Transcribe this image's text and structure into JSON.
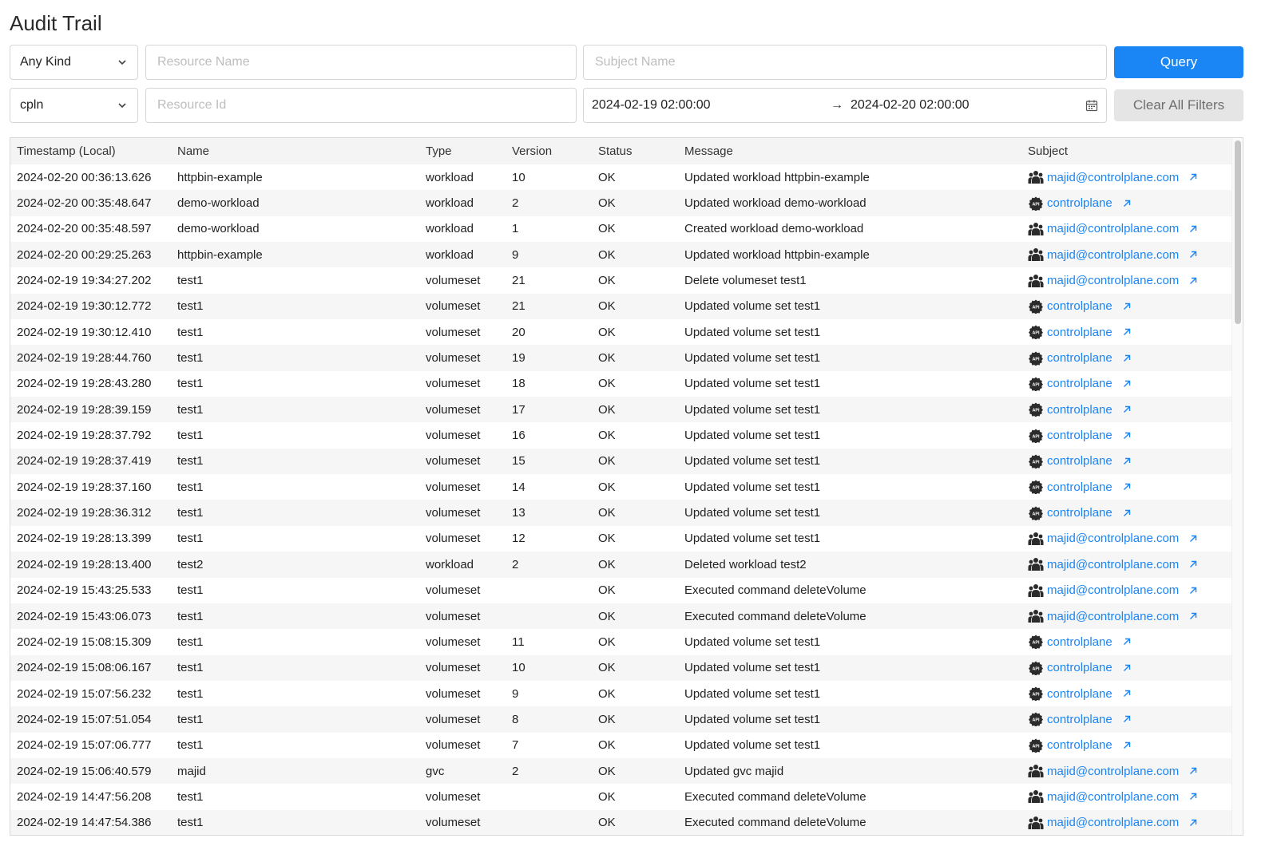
{
  "title": "Audit Trail",
  "filters": {
    "kind": "Any Kind",
    "resource_name_placeholder": "Resource Name",
    "subject_name_placeholder": "Subject Name",
    "context": "cpln",
    "resource_id_placeholder": "Resource Id",
    "date_from": "2024-02-19 02:00:00",
    "date_arrow": "→",
    "date_to": "2024-02-20 02:00:00",
    "query_label": "Query",
    "clear_label": "Clear All Filters"
  },
  "columns": {
    "timestamp": "Timestamp (Local)",
    "name": "Name",
    "type": "Type",
    "version": "Version",
    "status": "Status",
    "message": "Message",
    "subject": "Subject"
  },
  "rows": [
    {
      "timestamp": "2024-02-20 00:36:13.626",
      "name": "httpbin-example",
      "type": "workload",
      "version": "10",
      "status": "OK",
      "message": "Updated workload httpbin-example",
      "subject": "majid@controlplane.com",
      "subject_icon": "users-icon"
    },
    {
      "timestamp": "2024-02-20 00:35:48.647",
      "name": "demo-workload",
      "type": "workload",
      "version": "2",
      "status": "OK",
      "message": "Updated workload demo-workload",
      "subject": "controlplane",
      "subject_icon": "api-icon"
    },
    {
      "timestamp": "2024-02-20 00:35:48.597",
      "name": "demo-workload",
      "type": "workload",
      "version": "1",
      "status": "OK",
      "message": "Created workload demo-workload",
      "subject": "majid@controlplane.com",
      "subject_icon": "users-icon"
    },
    {
      "timestamp": "2024-02-20 00:29:25.263",
      "name": "httpbin-example",
      "type": "workload",
      "version": "9",
      "status": "OK",
      "message": "Updated workload httpbin-example",
      "subject": "majid@controlplane.com",
      "subject_icon": "users-icon"
    },
    {
      "timestamp": "2024-02-19 19:34:27.202",
      "name": "test1",
      "type": "volumeset",
      "version": "21",
      "status": "OK",
      "message": "Delete volumeset test1",
      "subject": "majid@controlplane.com",
      "subject_icon": "users-icon"
    },
    {
      "timestamp": "2024-02-19 19:30:12.772",
      "name": "test1",
      "type": "volumeset",
      "version": "21",
      "status": "OK",
      "message": "Updated volume set test1",
      "subject": "controlplane",
      "subject_icon": "api-icon"
    },
    {
      "timestamp": "2024-02-19 19:30:12.410",
      "name": "test1",
      "type": "volumeset",
      "version": "20",
      "status": "OK",
      "message": "Updated volume set test1",
      "subject": "controlplane",
      "subject_icon": "api-icon"
    },
    {
      "timestamp": "2024-02-19 19:28:44.760",
      "name": "test1",
      "type": "volumeset",
      "version": "19",
      "status": "OK",
      "message": "Updated volume set test1",
      "subject": "controlplane",
      "subject_icon": "api-icon"
    },
    {
      "timestamp": "2024-02-19 19:28:43.280",
      "name": "test1",
      "type": "volumeset",
      "version": "18",
      "status": "OK",
      "message": "Updated volume set test1",
      "subject": "controlplane",
      "subject_icon": "api-icon"
    },
    {
      "timestamp": "2024-02-19 19:28:39.159",
      "name": "test1",
      "type": "volumeset",
      "version": "17",
      "status": "OK",
      "message": "Updated volume set test1",
      "subject": "controlplane",
      "subject_icon": "api-icon"
    },
    {
      "timestamp": "2024-02-19 19:28:37.792",
      "name": "test1",
      "type": "volumeset",
      "version": "16",
      "status": "OK",
      "message": "Updated volume set test1",
      "subject": "controlplane",
      "subject_icon": "api-icon"
    },
    {
      "timestamp": "2024-02-19 19:28:37.419",
      "name": "test1",
      "type": "volumeset",
      "version": "15",
      "status": "OK",
      "message": "Updated volume set test1",
      "subject": "controlplane",
      "subject_icon": "api-icon"
    },
    {
      "timestamp": "2024-02-19 19:28:37.160",
      "name": "test1",
      "type": "volumeset",
      "version": "14",
      "status": "OK",
      "message": "Updated volume set test1",
      "subject": "controlplane",
      "subject_icon": "api-icon"
    },
    {
      "timestamp": "2024-02-19 19:28:36.312",
      "name": "test1",
      "type": "volumeset",
      "version": "13",
      "status": "OK",
      "message": "Updated volume set test1",
      "subject": "controlplane",
      "subject_icon": "api-icon"
    },
    {
      "timestamp": "2024-02-19 19:28:13.399",
      "name": "test1",
      "type": "volumeset",
      "version": "12",
      "status": "OK",
      "message": "Updated volume set test1",
      "subject": "majid@controlplane.com",
      "subject_icon": "users-icon"
    },
    {
      "timestamp": "2024-02-19 19:28:13.400",
      "name": "test2",
      "type": "workload",
      "version": "2",
      "status": "OK",
      "message": "Deleted workload test2",
      "subject": "majid@controlplane.com",
      "subject_icon": "users-icon"
    },
    {
      "timestamp": "2024-02-19 15:43:25.533",
      "name": "test1",
      "type": "volumeset",
      "version": "",
      "status": "OK",
      "message": "Executed command deleteVolume",
      "subject": "majid@controlplane.com",
      "subject_icon": "users-icon"
    },
    {
      "timestamp": "2024-02-19 15:43:06.073",
      "name": "test1",
      "type": "volumeset",
      "version": "",
      "status": "OK",
      "message": "Executed command deleteVolume",
      "subject": "majid@controlplane.com",
      "subject_icon": "users-icon"
    },
    {
      "timestamp": "2024-02-19 15:08:15.309",
      "name": "test1",
      "type": "volumeset",
      "version": "11",
      "status": "OK",
      "message": "Updated volume set test1",
      "subject": "controlplane",
      "subject_icon": "api-icon"
    },
    {
      "timestamp": "2024-02-19 15:08:06.167",
      "name": "test1",
      "type": "volumeset",
      "version": "10",
      "status": "OK",
      "message": "Updated volume set test1",
      "subject": "controlplane",
      "subject_icon": "api-icon"
    },
    {
      "timestamp": "2024-02-19 15:07:56.232",
      "name": "test1",
      "type": "volumeset",
      "version": "9",
      "status": "OK",
      "message": "Updated volume set test1",
      "subject": "controlplane",
      "subject_icon": "api-icon"
    },
    {
      "timestamp": "2024-02-19 15:07:51.054",
      "name": "test1",
      "type": "volumeset",
      "version": "8",
      "status": "OK",
      "message": "Updated volume set test1",
      "subject": "controlplane",
      "subject_icon": "api-icon"
    },
    {
      "timestamp": "2024-02-19 15:07:06.777",
      "name": "test1",
      "type": "volumeset",
      "version": "7",
      "status": "OK",
      "message": "Updated volume set test1",
      "subject": "controlplane",
      "subject_icon": "api-icon"
    },
    {
      "timestamp": "2024-02-19 15:06:40.579",
      "name": "majid",
      "type": "gvc",
      "version": "2",
      "status": "OK",
      "message": "Updated gvc majid",
      "subject": "majid@controlplane.com",
      "subject_icon": "users-icon"
    },
    {
      "timestamp": "2024-02-19 14:47:56.208",
      "name": "test1",
      "type": "volumeset",
      "version": "",
      "status": "OK",
      "message": "Executed command deleteVolume",
      "subject": "majid@controlplane.com",
      "subject_icon": "users-icon"
    },
    {
      "timestamp": "2024-02-19 14:47:54.386",
      "name": "test1",
      "type": "volumeset",
      "version": "",
      "status": "OK",
      "message": "Executed command deleteVolume",
      "subject": "majid@controlplane.com",
      "subject_icon": "users-icon"
    }
  ],
  "colors": {
    "accent": "#1a85f5",
    "clear_button_bg": "#e5e5e5",
    "header_bg": "#f4f4f4",
    "stripe_bg": "#f6f6f6"
  }
}
